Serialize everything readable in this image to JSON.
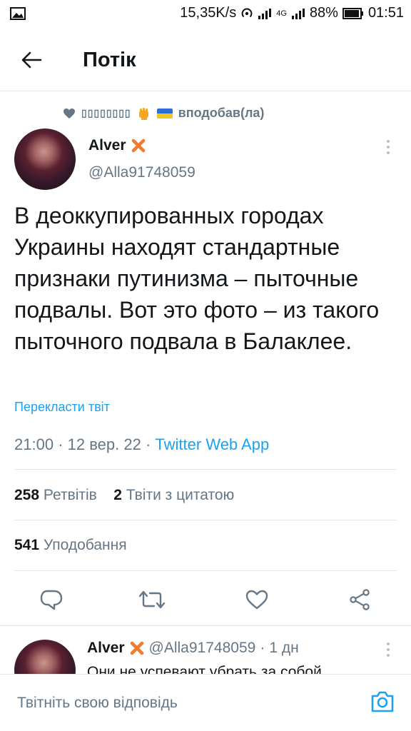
{
  "statusbar": {
    "net_speed": "15,35K/s",
    "network_type": "4G",
    "battery": "88%",
    "time": "01:51"
  },
  "appbar": {
    "title": "Потік"
  },
  "social_context": {
    "name": "▯▯▯▯▯▯▯▯",
    "action": "вподобав(ла)"
  },
  "tweet": {
    "author_name": "Alver",
    "author_handle": "@Alla91748059",
    "text": "В деоккупированных городах Украины находят стандартные признаки путинизма – пыточные подвалы. Вот это фото – из такого пыточного подвала в Балаклее.",
    "translate_label": "Перекласти твіт",
    "time": "21:00",
    "date": "12 вер. 22",
    "app": "Twitter Web App",
    "retweets_count": "258",
    "retweets_label": "Ретвітів",
    "quotes_count": "2",
    "quotes_label": "Твіти з цитатою",
    "likes_count": "541",
    "likes_label": "Уподобання"
  },
  "reply": {
    "author_name": "Alver",
    "author_handle": "@Alla91748059",
    "age": "1 дн",
    "preview": "Они не успевают убрать за собой"
  },
  "reply_bar": {
    "placeholder": "Твітніть свою відповідь"
  },
  "colors": {
    "accent": "#1da1f2",
    "muted": "#657786",
    "x_mark": "#f27a2e"
  }
}
